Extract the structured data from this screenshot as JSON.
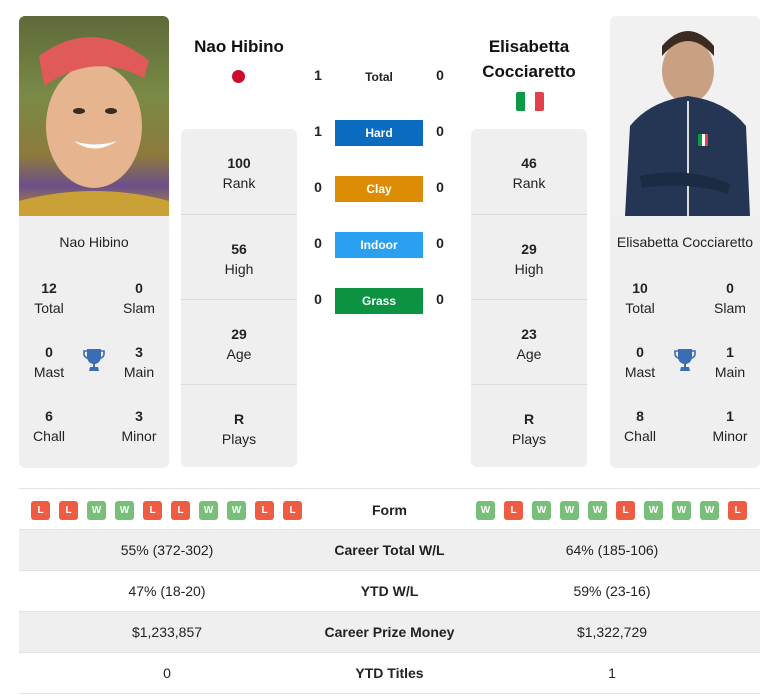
{
  "players": {
    "left": {
      "name": "Nao Hibino",
      "card_name": "Nao Hibino",
      "country_flag": "japan-flag",
      "photo": "player-photo",
      "titles": {
        "total": {
          "value": "12",
          "label": "Total"
        },
        "slam": {
          "value": "0",
          "label": "Slam"
        },
        "mast": {
          "value": "0",
          "label": "Mast"
        },
        "main": {
          "value": "3",
          "label": "Main"
        },
        "chall": {
          "value": "6",
          "label": "Chall"
        },
        "minor": {
          "value": "3",
          "label": "Minor"
        }
      },
      "stats": {
        "rank": {
          "value": "100",
          "label": "Rank"
        },
        "high": {
          "value": "56",
          "label": "High"
        },
        "age": {
          "value": "29",
          "label": "Age"
        },
        "plays": {
          "value": "R",
          "label": "Plays"
        }
      }
    },
    "right": {
      "name": "Elisabetta Cocciaretto",
      "card_name": "Elisabetta Cocciaretto",
      "country_flag": "italy-flag",
      "photo": "player-photo",
      "titles": {
        "total": {
          "value": "10",
          "label": "Total"
        },
        "slam": {
          "value": "0",
          "label": "Slam"
        },
        "mast": {
          "value": "0",
          "label": "Mast"
        },
        "main": {
          "value": "1",
          "label": "Main"
        },
        "chall": {
          "value": "8",
          "label": "Chall"
        },
        "minor": {
          "value": "1",
          "label": "Minor"
        }
      },
      "stats": {
        "rank": {
          "value": "46",
          "label": "Rank"
        },
        "high": {
          "value": "29",
          "label": "High"
        },
        "age": {
          "value": "23",
          "label": "Age"
        },
        "plays": {
          "value": "R",
          "label": "Plays"
        }
      }
    }
  },
  "h2h": {
    "total": {
      "label": "Total",
      "left": "1",
      "right": "0"
    },
    "surfaces": [
      {
        "label": "Hard",
        "left": "1",
        "right": "0",
        "color": "#0a6bbf"
      },
      {
        "label": "Clay",
        "left": "0",
        "right": "0",
        "color": "#dd8c05"
      },
      {
        "label": "Indoor",
        "left": "0",
        "right": "0",
        "color": "#2b9ff0"
      },
      {
        "label": "Grass",
        "left": "0",
        "right": "0",
        "color": "#0b9341"
      }
    ]
  },
  "form": {
    "label": "Form",
    "left": [
      "L",
      "L",
      "W",
      "W",
      "L",
      "L",
      "W",
      "W",
      "L",
      "L"
    ],
    "right": [
      "W",
      "L",
      "W",
      "W",
      "W",
      "L",
      "W",
      "W",
      "W",
      "L"
    ],
    "colors": {
      "W": "#78bf7a",
      "L": "#ee5c44"
    }
  },
  "comparison": [
    {
      "label": "Career Total W/L",
      "left": "55% (372-302)",
      "right": "64% (185-106)"
    },
    {
      "label": "YTD W/L",
      "left": "47% (18-20)",
      "right": "59% (23-16)"
    },
    {
      "label": "Career Prize Money",
      "left": "$1,233,857",
      "right": "$1,322,729"
    },
    {
      "label": "YTD Titles",
      "left": "0",
      "right": "1"
    }
  ],
  "colors": {
    "trophy": "#3a6db5",
    "card_bg": "#efefef",
    "japan_red": "#cc0b2c",
    "italy": [
      "#0b9a45",
      "#ffffff",
      "#e2414b"
    ]
  }
}
